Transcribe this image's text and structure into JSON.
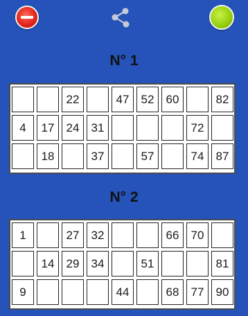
{
  "colors": {
    "background": "#2553b9",
    "remove_button": "#e3251d",
    "status_button": "#97d20f",
    "share_icon": "#c5cbd6"
  },
  "icons": {
    "remove": "minus-circle-icon",
    "share": "share-icon",
    "status": "green-dot-icon"
  },
  "cards": [
    {
      "title": "N° 1",
      "rows": [
        [
          "",
          "",
          "22",
          "",
          "47",
          "52",
          "60",
          "",
          "82"
        ],
        [
          "4",
          "17",
          "24",
          "31",
          "",
          "",
          "",
          "72",
          ""
        ],
        [
          "",
          "18",
          "",
          "37",
          "",
          "57",
          "",
          "74",
          "87"
        ]
      ]
    },
    {
      "title": "N° 2",
      "rows": [
        [
          "1",
          "",
          "27",
          "32",
          "",
          "",
          "66",
          "70",
          ""
        ],
        [
          "",
          "14",
          "29",
          "34",
          "",
          "51",
          "",
          "",
          "81"
        ],
        [
          "9",
          "",
          "",
          "",
          "44",
          "",
          "68",
          "77",
          "90"
        ]
      ]
    }
  ]
}
